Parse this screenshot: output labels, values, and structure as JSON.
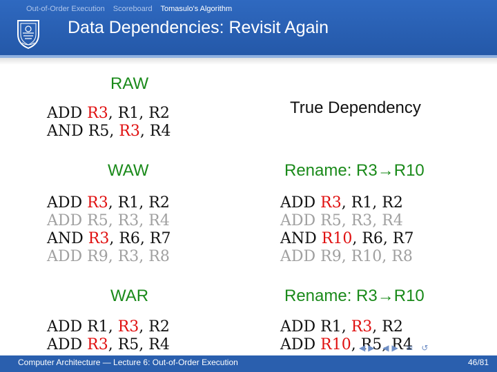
{
  "header": {
    "nav": [
      "Out-of-Order Execution",
      "Scoreboard",
      "Tomasulo's Algorithm"
    ],
    "title": "Data Dependencies: Revisit Again"
  },
  "raw": {
    "heading": "RAW",
    "note": "True Dependency",
    "lines": [
      [
        {
          "t": "ADD "
        },
        {
          "t": "R3",
          "hl": true
        },
        {
          "t": ", R1, R2"
        }
      ],
      [
        {
          "t": "AND R5, "
        },
        {
          "t": "R3",
          "hl": true
        },
        {
          "t": ", R4"
        }
      ]
    ]
  },
  "waw": {
    "heading": "WAW",
    "lines": [
      {
        "dim": false,
        "parts": [
          {
            "t": "ADD "
          },
          {
            "t": "R3",
            "hl": true
          },
          {
            "t": ", R1, R2"
          }
        ]
      },
      {
        "dim": true,
        "parts": [
          {
            "t": "ADD R5, R3, R4"
          }
        ]
      },
      {
        "dim": false,
        "parts": [
          {
            "t": "AND "
          },
          {
            "t": "R3",
            "hl": true
          },
          {
            "t": ", R6, R7"
          }
        ]
      },
      {
        "dim": true,
        "parts": [
          {
            "t": "ADD R9, R3, R8"
          }
        ]
      }
    ]
  },
  "waw_rename": {
    "heading": "Rename: R3→R10",
    "lines": [
      {
        "dim": false,
        "parts": [
          {
            "t": "ADD "
          },
          {
            "t": "R3",
            "hl": true
          },
          {
            "t": ", R1, R2"
          }
        ]
      },
      {
        "dim": true,
        "parts": [
          {
            "t": "ADD R5, R3, R4"
          }
        ]
      },
      {
        "dim": false,
        "parts": [
          {
            "t": "AND "
          },
          {
            "t": "R10",
            "hl": true
          },
          {
            "t": ", R6, R7"
          }
        ]
      },
      {
        "dim": true,
        "parts": [
          {
            "t": "ADD R9, R10, R8"
          }
        ]
      }
    ]
  },
  "war": {
    "heading": "WAR",
    "lines": [
      [
        {
          "t": "ADD R1, "
        },
        {
          "t": "R3",
          "hl": true
        },
        {
          "t": ", R2"
        }
      ],
      [
        {
          "t": "ADD "
        },
        {
          "t": "R3",
          "hl": true
        },
        {
          "t": ", R5, R4"
        }
      ]
    ]
  },
  "war_rename": {
    "heading": "Rename: R3→R10",
    "lines": [
      [
        {
          "t": "ADD R1, "
        },
        {
          "t": "R3",
          "hl": true
        },
        {
          "t": ", R2"
        }
      ],
      [
        {
          "t": "ADD "
        },
        {
          "t": "R10",
          "hl": true
        },
        {
          "t": ", R5, R4"
        }
      ]
    ]
  },
  "footer": {
    "left": "Computer Architecture — Lecture 6: Out-of-Order Execution",
    "right": "46/81"
  },
  "colors": {
    "highlight": "#e01010",
    "heading": "#1a8a1a",
    "header": "#2a5fae"
  }
}
